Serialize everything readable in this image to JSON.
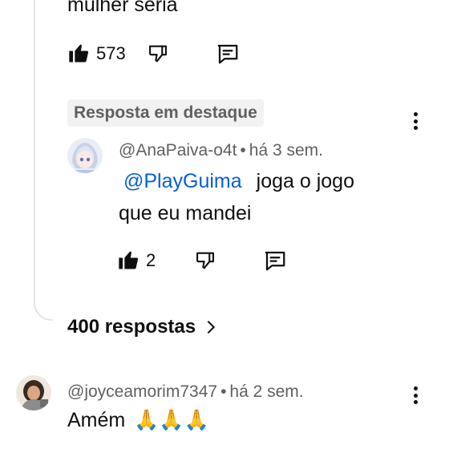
{
  "previous_comment": {
    "text_tail": "mulher seria",
    "like_count": "573"
  },
  "highlighted_reply": {
    "badge_label": "Resposta em destaque",
    "author": "@AnaPaiva-o4t",
    "time": "há 3 sem.",
    "mention": "@PlayGuima",
    "text": "joga o jogo que eu mandei",
    "like_count": "2"
  },
  "replies_link": {
    "label": "400 respostas"
  },
  "next_comment": {
    "author": "@joyceamorim7347",
    "time": "há 2 sem.",
    "text": "Amém",
    "emoji": "🙏🙏🙏"
  },
  "separator": "•",
  "icons": [
    "like-icon",
    "dislike-icon",
    "reply-icon",
    "more-options-icon",
    "chevron-right-icon"
  ]
}
